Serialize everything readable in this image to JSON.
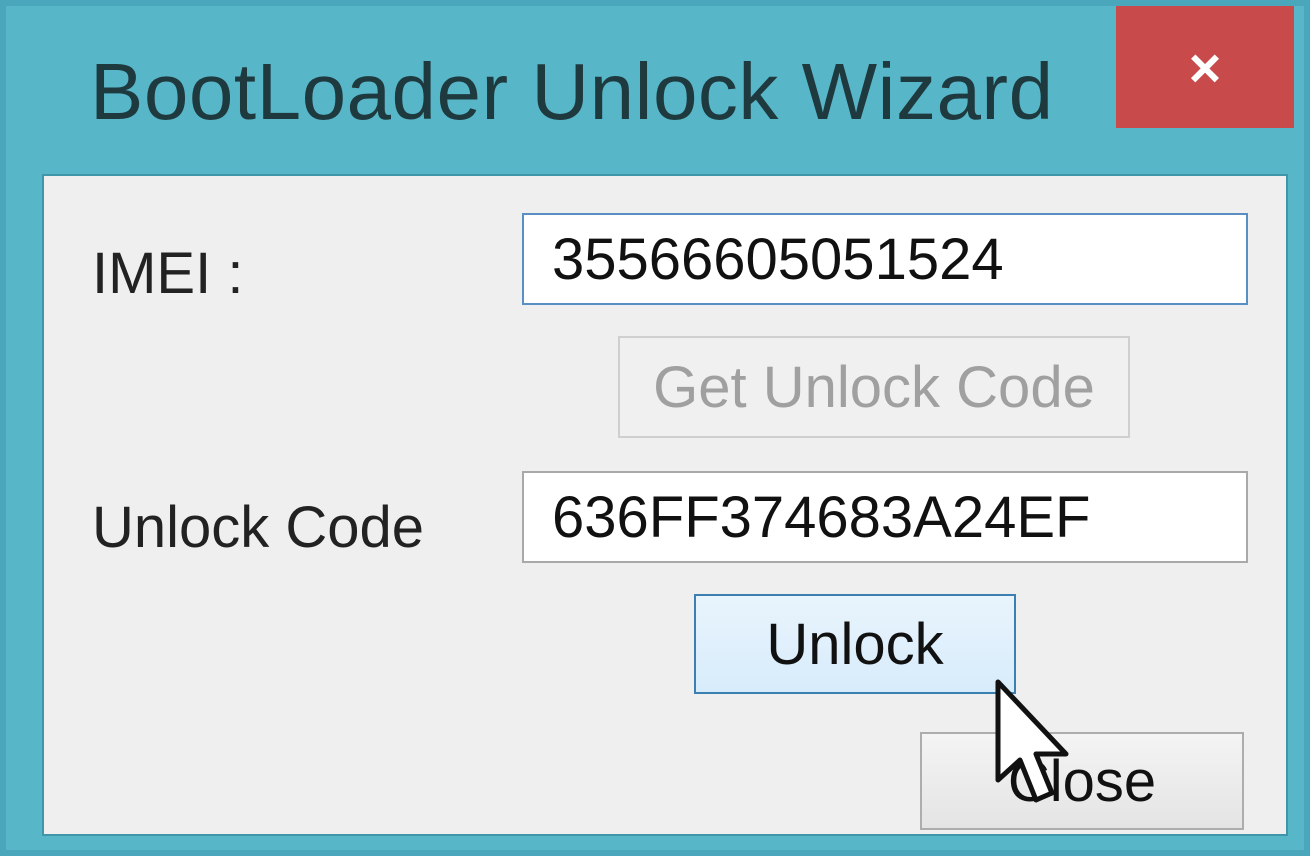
{
  "window": {
    "title": "BootLoader Unlock Wizard",
    "close_glyph": "×",
    "colors": {
      "frame": "#58b6c9",
      "close_button": "#c94a4a",
      "client_bg": "#efefef"
    }
  },
  "form": {
    "imei": {
      "label": "IMEI :",
      "value": "35566605051524"
    },
    "get_code_button": {
      "label": "Get Unlock Code",
      "state": "disabled"
    },
    "unlock_code": {
      "label": "Unlock Code",
      "value": "636FF374683A24EF"
    },
    "unlock_button": {
      "label": "Unlock",
      "state": "hover"
    },
    "close_button": {
      "label": "Close"
    }
  },
  "icons": {
    "mouse_cursor": "arrow-pointer-icon",
    "close": "close-icon"
  }
}
